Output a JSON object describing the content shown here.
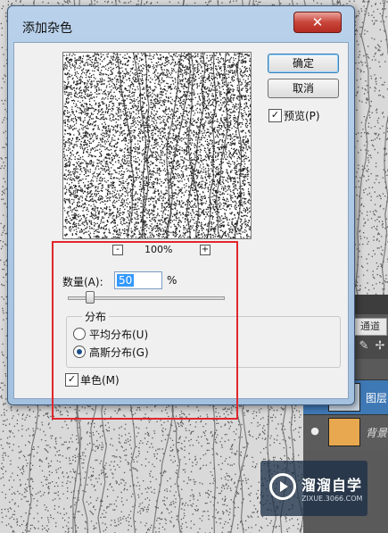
{
  "dialog": {
    "title": "添加杂色",
    "close_label": "✕",
    "ok_label": "确定",
    "cancel_label": "取消",
    "preview_label": "预览(P)",
    "preview_checked": true,
    "zoom": {
      "minus": "-",
      "plus": "+",
      "value": "100%"
    },
    "amount": {
      "label": "数量(A):",
      "value": "50",
      "unit": "%",
      "slider_fraction": 0.14
    },
    "distribution": {
      "title": "分布",
      "options": [
        {
          "label": "平均分布(U)",
          "selected": false
        },
        {
          "label": "高斯分布(G)",
          "selected": true
        }
      ]
    },
    "monochrome": {
      "label": "单色(M)",
      "checked": true
    }
  },
  "layers_panel": {
    "tab_label": "通道",
    "layers": [
      {
        "name": "图层",
        "selected": true,
        "thumb_color": "#c9d6e3"
      },
      {
        "name": "背景",
        "selected": false,
        "thumb_color": "#e8a84f"
      }
    ],
    "tools": [
      "brush-icon",
      "move-icon"
    ]
  },
  "watermark": {
    "title": "溜溜自学",
    "url": "ZIXUE.3066.COM"
  },
  "colors": {
    "highlight": "#e0262c",
    "selection": "#3399ff",
    "titlebar": "#b9d1ea",
    "close": "#c8453a"
  }
}
